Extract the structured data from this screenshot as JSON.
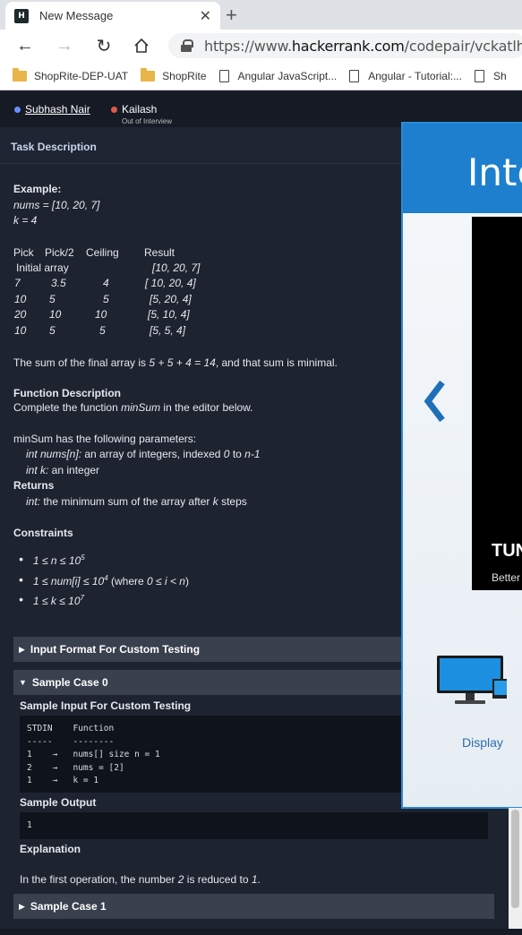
{
  "browser": {
    "tab_title": "New Message",
    "favicon_text": "H",
    "url_prefix": "https://www.",
    "url_domain": "hackerrank.com",
    "url_path": "/codepair/vckatlhgrbl",
    "bookmarks": [
      {
        "label": "ShopRite-DEP-UAT",
        "icon": "folder-icon"
      },
      {
        "label": "ShopRite",
        "icon": "folder-icon"
      },
      {
        "label": "Angular JavaScript...",
        "icon": "page-icon"
      },
      {
        "label": "Angular - Tutorial:...",
        "icon": "page-icon"
      },
      {
        "label": "Sh",
        "icon": "page-icon"
      }
    ]
  },
  "participants": {
    "p1_name": "Subhash Nair",
    "p2_name": "Kailash",
    "p2_status": "Out of Interview",
    "p1_color": "#6b8cff",
    "p2_color": "#e05a4a"
  },
  "task": {
    "header": "Task Description",
    "example_label": "Example:",
    "nums_line": "nums = [10, 20, 7]",
    "k_line": "k = 4",
    "table_headers": [
      "Pick",
      "Pick/2",
      "Ceiling",
      "Result"
    ],
    "initial_label": "Initial array",
    "initial_value": "[10, 20, 7]",
    "rows": [
      [
        "7",
        "3.5",
        "4",
        "[ 10, 20, 4]"
      ],
      [
        "10",
        "5",
        "5",
        "[5, 20, 4]"
      ],
      [
        "20",
        "10",
        "10",
        "[5, 10, 4]"
      ],
      [
        "10",
        "5",
        "5",
        "[5, 5, 4]"
      ]
    ],
    "sum_text_a": "The sum of the final array is ",
    "sum_text_b": "5 + 5 + 4 = 14",
    "sum_text_c": ", and that sum is minimal.",
    "func_desc_title": "Function Description",
    "func_desc_a": "Complete the function ",
    "func_desc_b": "minSum",
    "func_desc_c": " in the editor below.",
    "params_intro": "minSum has the following parameters:",
    "param1_a": "int nums[n]:",
    "param1_b": "  an array of integers, indexed ",
    "param1_c": "0",
    "param1_d": " to ",
    "param1_e": "n-1",
    "param2_a": "int k:",
    "param2_b": "  an integer",
    "returns_title": "Returns",
    "returns_a": "int:",
    "returns_b": "  the minimum sum of the array after ",
    "returns_c": "k",
    "returns_d": " steps",
    "constraints_title": "Constraints",
    "c1_a": "1 ≤ n ≤ 10",
    "c1_sup": "5",
    "c2_a": "1 ≤ num[i] ≤ 10",
    "c2_sup": "4",
    "c2_b": " (where ",
    "c2_c": "0 ≤ i < n",
    "c2_d": ")",
    "c3_a": "1 ≤ k ≤ 10",
    "c3_sup": "7"
  },
  "sections": {
    "input_format": "Input Format For Custom Testing",
    "sample0": "Sample Case 0",
    "sample0_input_title": "Sample Input For Custom Testing",
    "sample0_code": [
      "STDIN    Function",
      "-----    --------",
      "1    →   nums[] size n = 1",
      "2    →   nums = [2]",
      "1    →   k = 1"
    ],
    "sample_output_title": "Sample Output",
    "sample_output": "1",
    "explanation_title": "Explanation",
    "expl_a": "In the first operation, the number ",
    "expl_b": "2",
    "expl_c": " is reduced to ",
    "expl_d": "1",
    "expl_e": ".",
    "sample1": "Sample Case 1"
  },
  "overlay": {
    "title": "Inte",
    "video_title": "TUN",
    "video_sub": "Better",
    "display_label": "Display",
    "accent": "#1e7fcf"
  }
}
